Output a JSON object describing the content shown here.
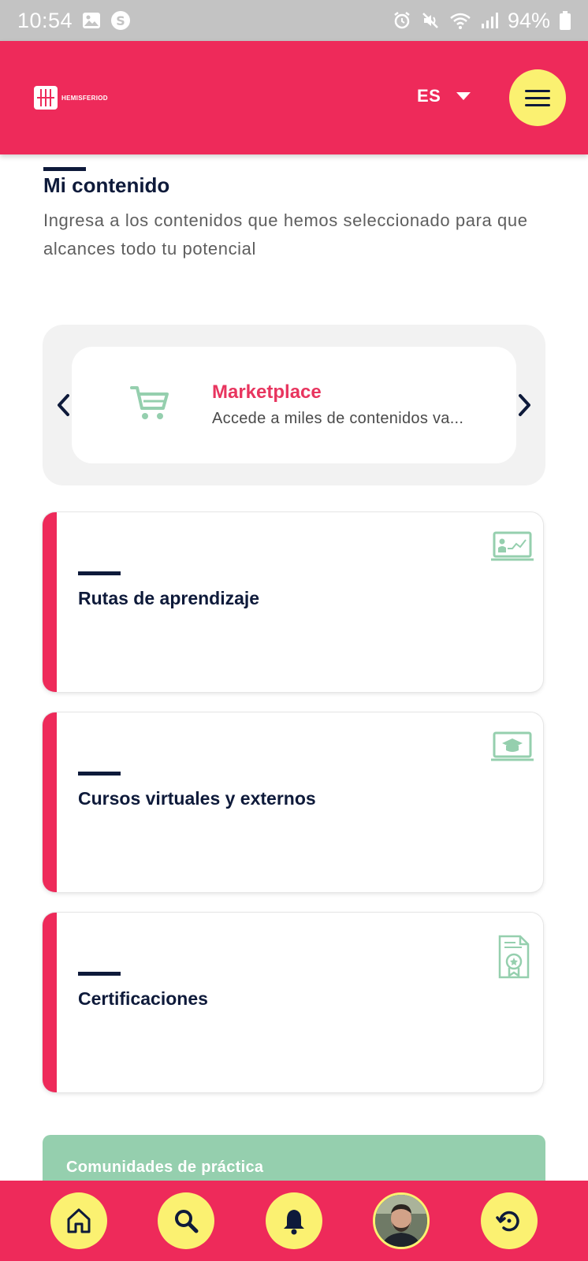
{
  "status_bar": {
    "time": "10:54",
    "battery": "94%",
    "icons": [
      "gallery-icon",
      "s-app-icon",
      "alarm-icon",
      "mute-icon",
      "wifi-icon",
      "signal-icon",
      "battery-icon"
    ]
  },
  "header": {
    "logo_text": "HEMISFERIOD",
    "language": "ES",
    "menu_icon": "hamburger-icon",
    "colors": {
      "brand": "#ee2a5a",
      "accent": "#fbf171",
      "navy": "#0e1a3a",
      "green": "#95cfae"
    }
  },
  "section": {
    "title": "Mi contenido",
    "subtitle": "Ingresa a los contenidos que hemos seleccionado para que alcances todo tu potencial"
  },
  "carousel": {
    "title": "Marketplace",
    "description": "Accede a miles de contenidos va...",
    "icon": "shopping-cart-icon"
  },
  "cards": [
    {
      "title": "Rutas de aprendizaje",
      "icon": "presentation-board-icon"
    },
    {
      "title": "Cursos virtuales y externos",
      "icon": "laptop-graduation-icon"
    },
    {
      "title": "Certificaciones",
      "icon": "certificate-icon"
    }
  ],
  "community": {
    "title": "Comunidades de práctica"
  },
  "bottom_nav": {
    "items": [
      "home-icon",
      "search-icon",
      "bell-icon",
      "profile-avatar",
      "history-icon"
    ]
  }
}
